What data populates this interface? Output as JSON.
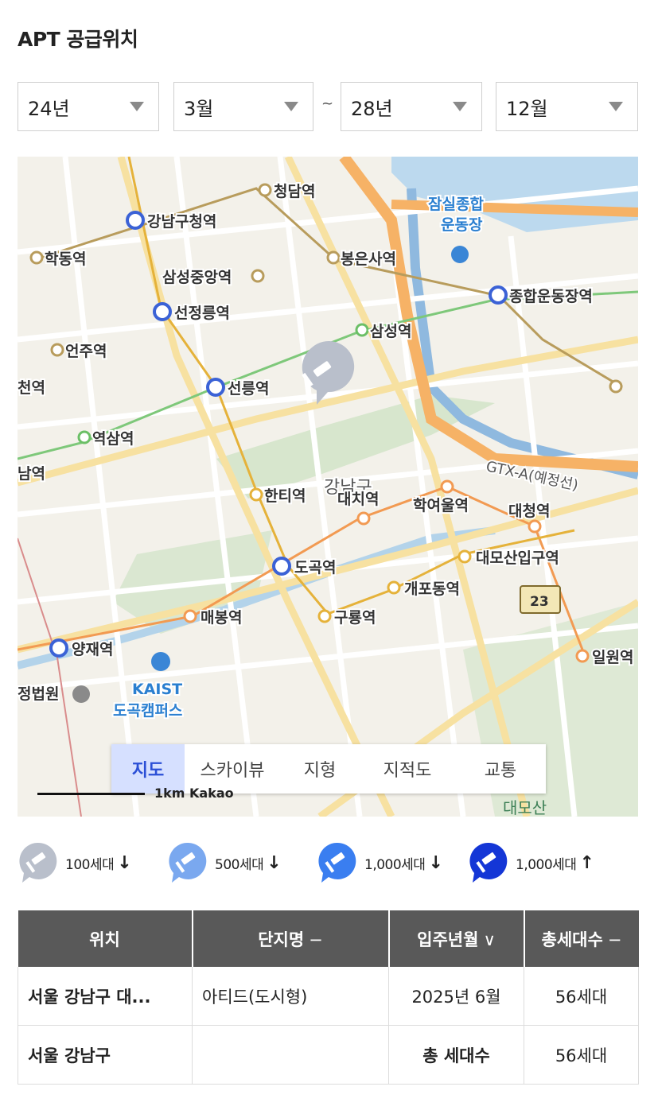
{
  "title": "APT 공급위치",
  "filters": {
    "start_year": "24년",
    "start_month": "3월",
    "separator": "~",
    "end_year": "28년",
    "end_month": "12월"
  },
  "map": {
    "stations": [
      "청담역",
      "강남구청역",
      "잠실종합",
      "운동장",
      "학동역",
      "봉은사역",
      "삼성중앙역",
      "종합운동장역",
      "선정릉역",
      "삼성역",
      "언주역",
      "천역",
      "선릉역",
      "역삼역",
      "GTX-A(예정선)",
      "남역",
      "강남구",
      "대치역",
      "한티역",
      "학여울역",
      "대청역",
      "대모산입구역",
      "도곡역",
      "개포동역",
      "23",
      "매봉역",
      "구룡역",
      "일원역",
      "양재역",
      "KAIST",
      "도곡캠퍼스",
      "정법원"
    ],
    "tabs": [
      "지도",
      "스카이뷰",
      "지형",
      "지적도",
      "교통"
    ],
    "active_tab": "지도",
    "scale": "1km",
    "provider": "Kakao",
    "corner_label": "대모산"
  },
  "legend": [
    {
      "label": "100세대",
      "arrow": "↓",
      "color": "#b9bfcb"
    },
    {
      "label": "500세대",
      "arrow": "↓",
      "color": "#7aa8ef"
    },
    {
      "label": "1,000세대",
      "arrow": "↓",
      "color": "#3a7ef0"
    },
    {
      "label": "1,000세대",
      "arrow": "↑",
      "color": "#1436d6"
    }
  ],
  "table": {
    "headers": {
      "location": "위치",
      "complex": "단지명",
      "complex_sort": "−",
      "move_in": "입주년월",
      "move_in_sort": "∨",
      "households": "총세대수",
      "households_sort": "−"
    },
    "rows": [
      {
        "location": "서울 강남구 대...",
        "complex": "아티드(도시형)",
        "move_in": "2025년 6월",
        "households": "56세대"
      }
    ],
    "total": {
      "location": "서울 강남구",
      "label": "총 세대수",
      "households": "56세대"
    }
  }
}
